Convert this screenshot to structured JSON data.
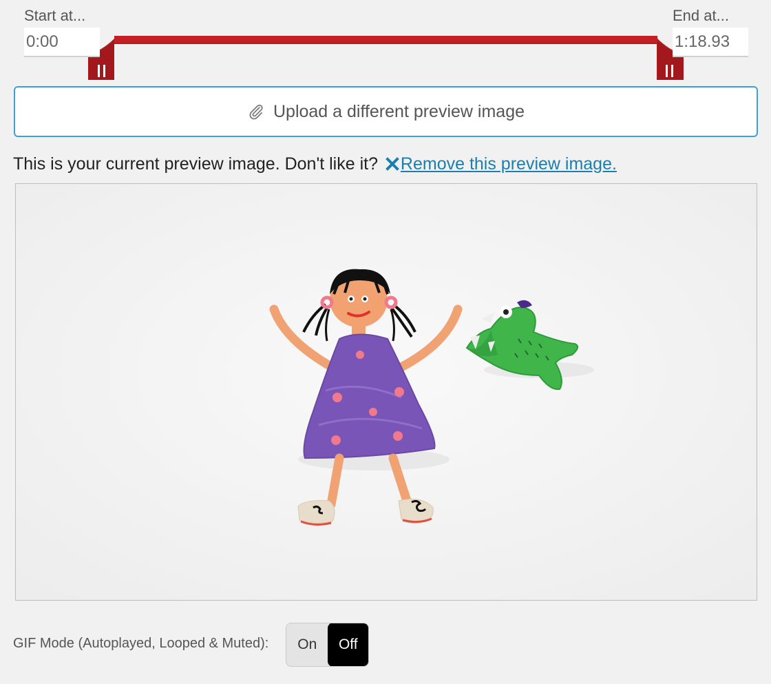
{
  "range": {
    "start_label": "Start at...",
    "start_value": "0:00",
    "end_label": "End at...",
    "end_value": "1:18.93",
    "accent_color": "#b01e22"
  },
  "upload": {
    "icon": "paperclip-icon",
    "label": "Upload a different preview image"
  },
  "preview": {
    "info_text": "This is your current preview image. Don't like it?",
    "remove_icon": "close-x-icon",
    "remove_label": "Remove this preview image."
  },
  "gif_mode": {
    "label": "GIF Mode (Autoplayed, Looped & Muted):",
    "on_label": "On",
    "off_label": "Off",
    "selected": "Off"
  },
  "colors": {
    "link": "#1a7fb0",
    "upload_border": "#3aa3d6"
  }
}
